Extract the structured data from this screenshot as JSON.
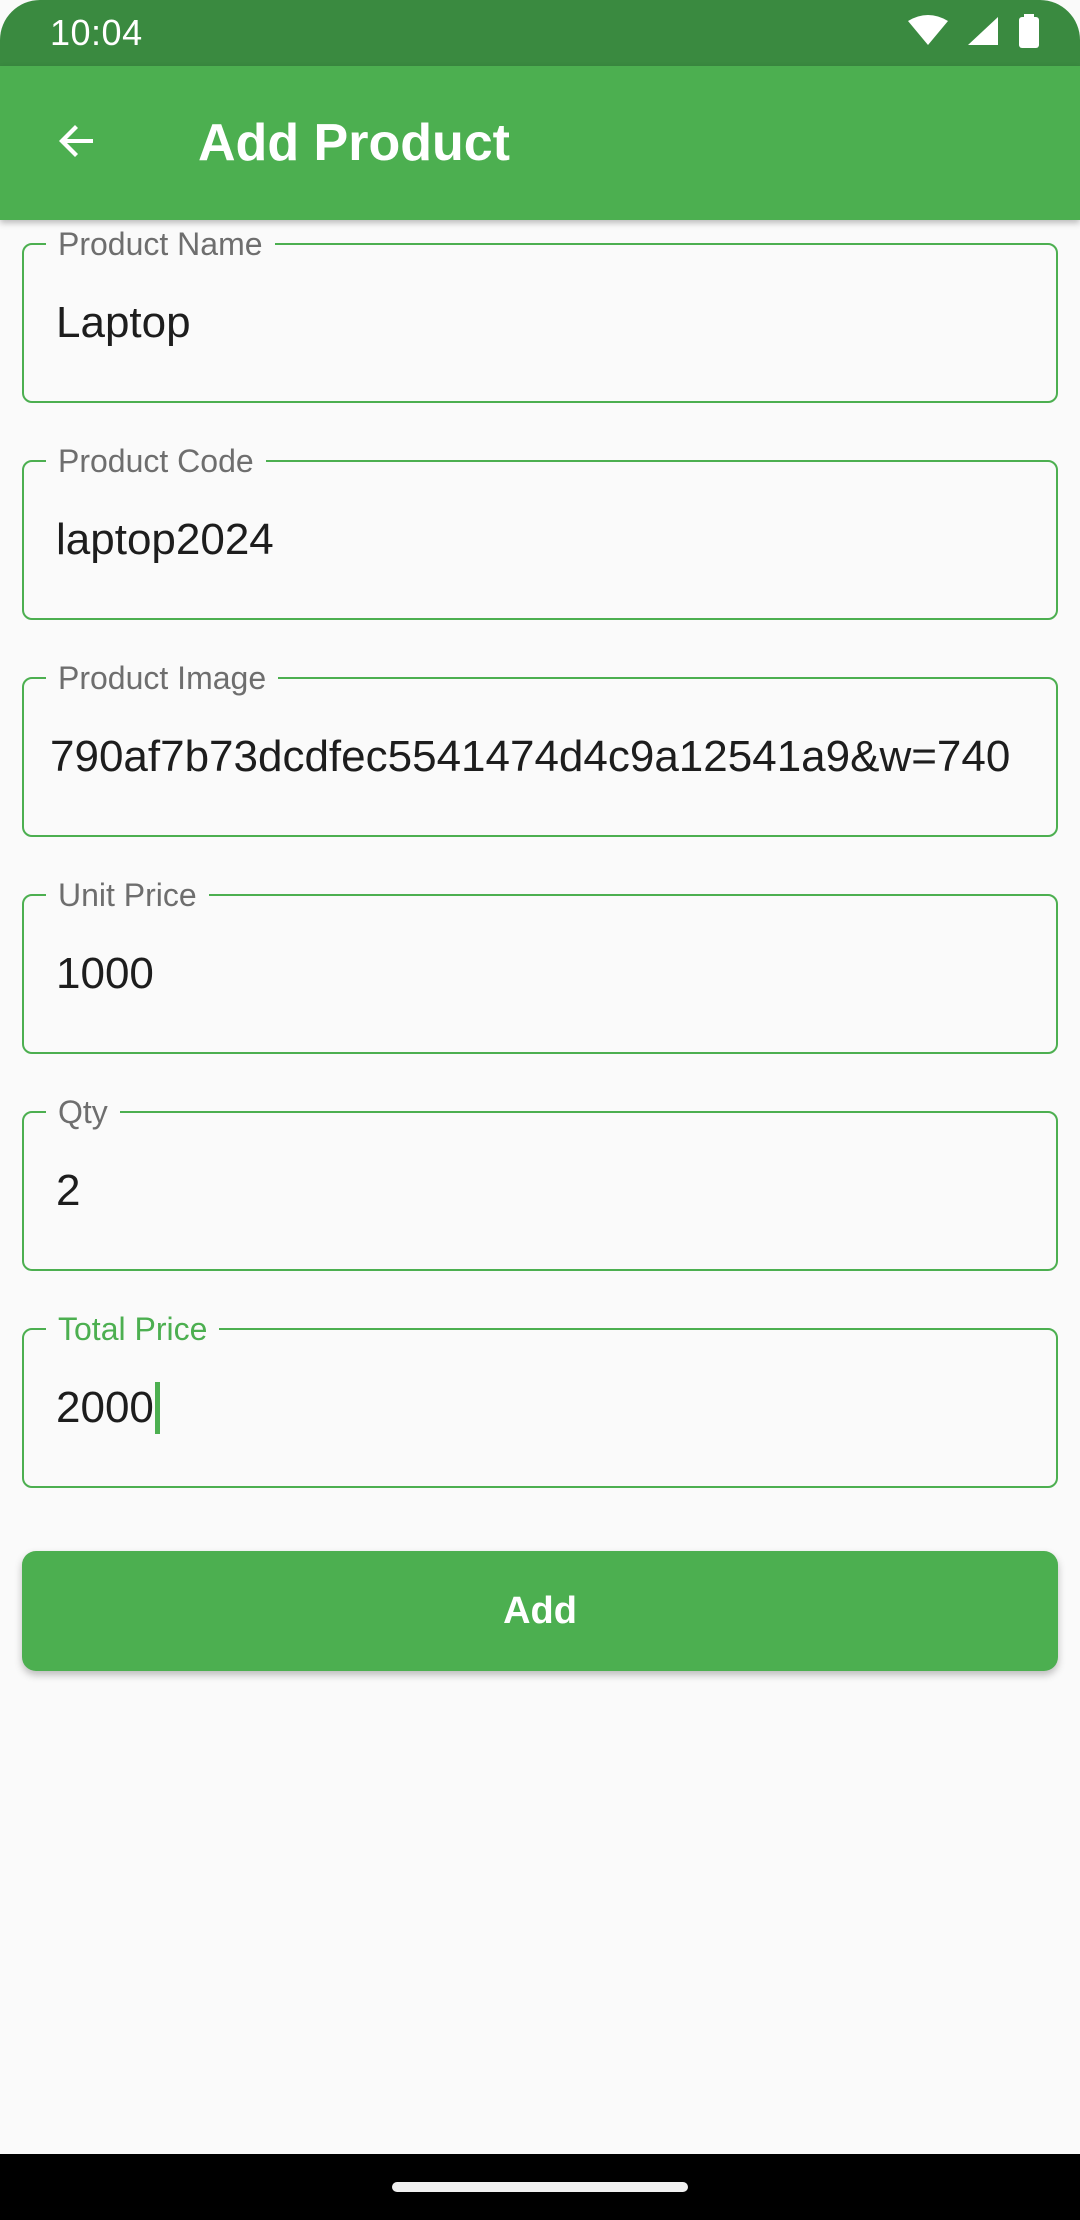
{
  "status_bar": {
    "time": "10:04",
    "icons": [
      "wifi-icon",
      "signal-icon",
      "battery-icon"
    ]
  },
  "app_bar": {
    "back_icon": "arrow-back-icon",
    "title": "Add Product",
    "background": "#4caf50"
  },
  "form": {
    "fields": [
      {
        "label": "Product Name",
        "value": "Laptop"
      },
      {
        "label": "Product Code",
        "value": "laptop2024"
      },
      {
        "label": "Product Image",
        "value": "790af7b73dcdfec5541474d4c9a12541a9&w=740"
      },
      {
        "label": "Unit Price",
        "value": "1000"
      },
      {
        "label": "Qty",
        "value": "2"
      },
      {
        "label": "Total Price",
        "value": "2000",
        "focused": true
      }
    ],
    "submit_label": "Add"
  },
  "colors": {
    "accent": "#4caf50",
    "status_bar": "#3a8a40",
    "background": "#fafafa"
  }
}
